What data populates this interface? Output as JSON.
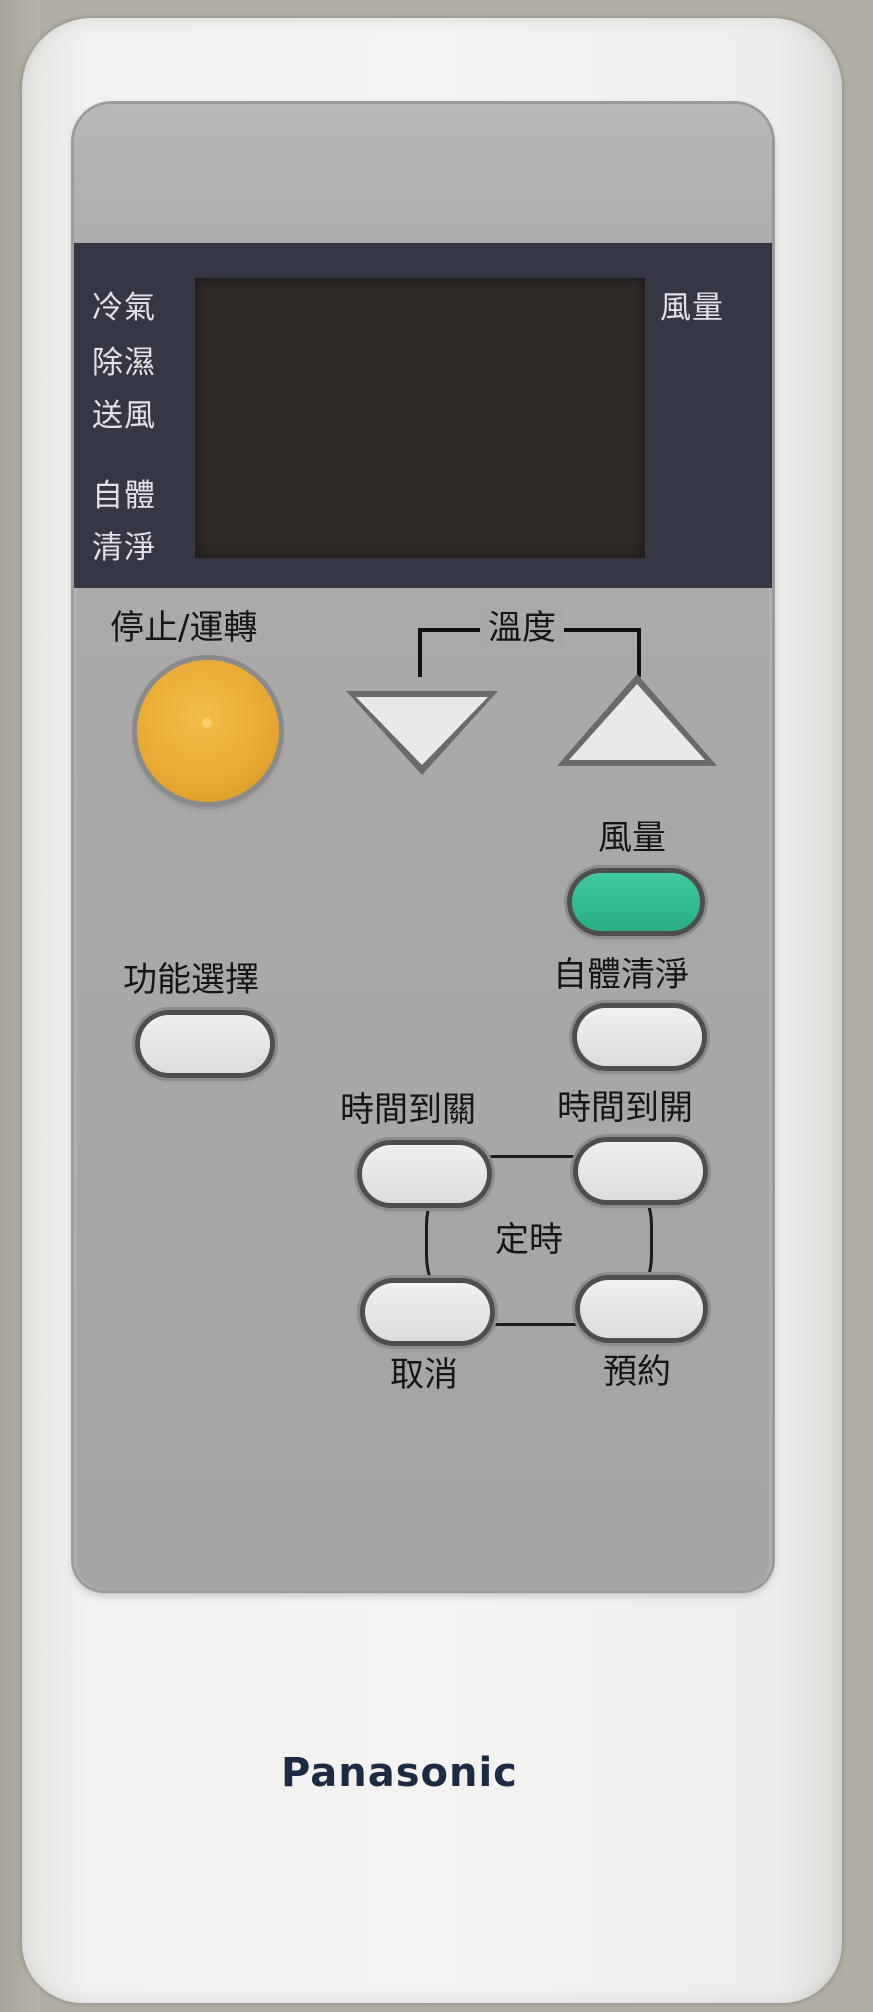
{
  "display": {
    "mode_labels": [
      "冷氣",
      "除濕",
      "送風",
      "自體",
      "清淨"
    ],
    "fan_label": "風量"
  },
  "buttons": {
    "power_label": "停止/運轉",
    "temperature_label": "溫度",
    "fan_label": "風量",
    "function_select_label": "功能選擇",
    "self_clean_label": "自體清淨",
    "off_timer_label": "時間到關",
    "on_timer_label": "時間到開",
    "timer_label": "定時",
    "cancel_label": "取消",
    "reserve_label": "預約"
  },
  "brand": {
    "logo_text": "Panasonic"
  },
  "colors": {
    "power_button": "#e8a934",
    "fan_button": "#2fb58e",
    "display_band": "#363744",
    "face_plate": "#aaaaaa"
  },
  "icons": {
    "temp_down": "triangle-down-icon",
    "temp_up": "triangle-up-icon"
  }
}
